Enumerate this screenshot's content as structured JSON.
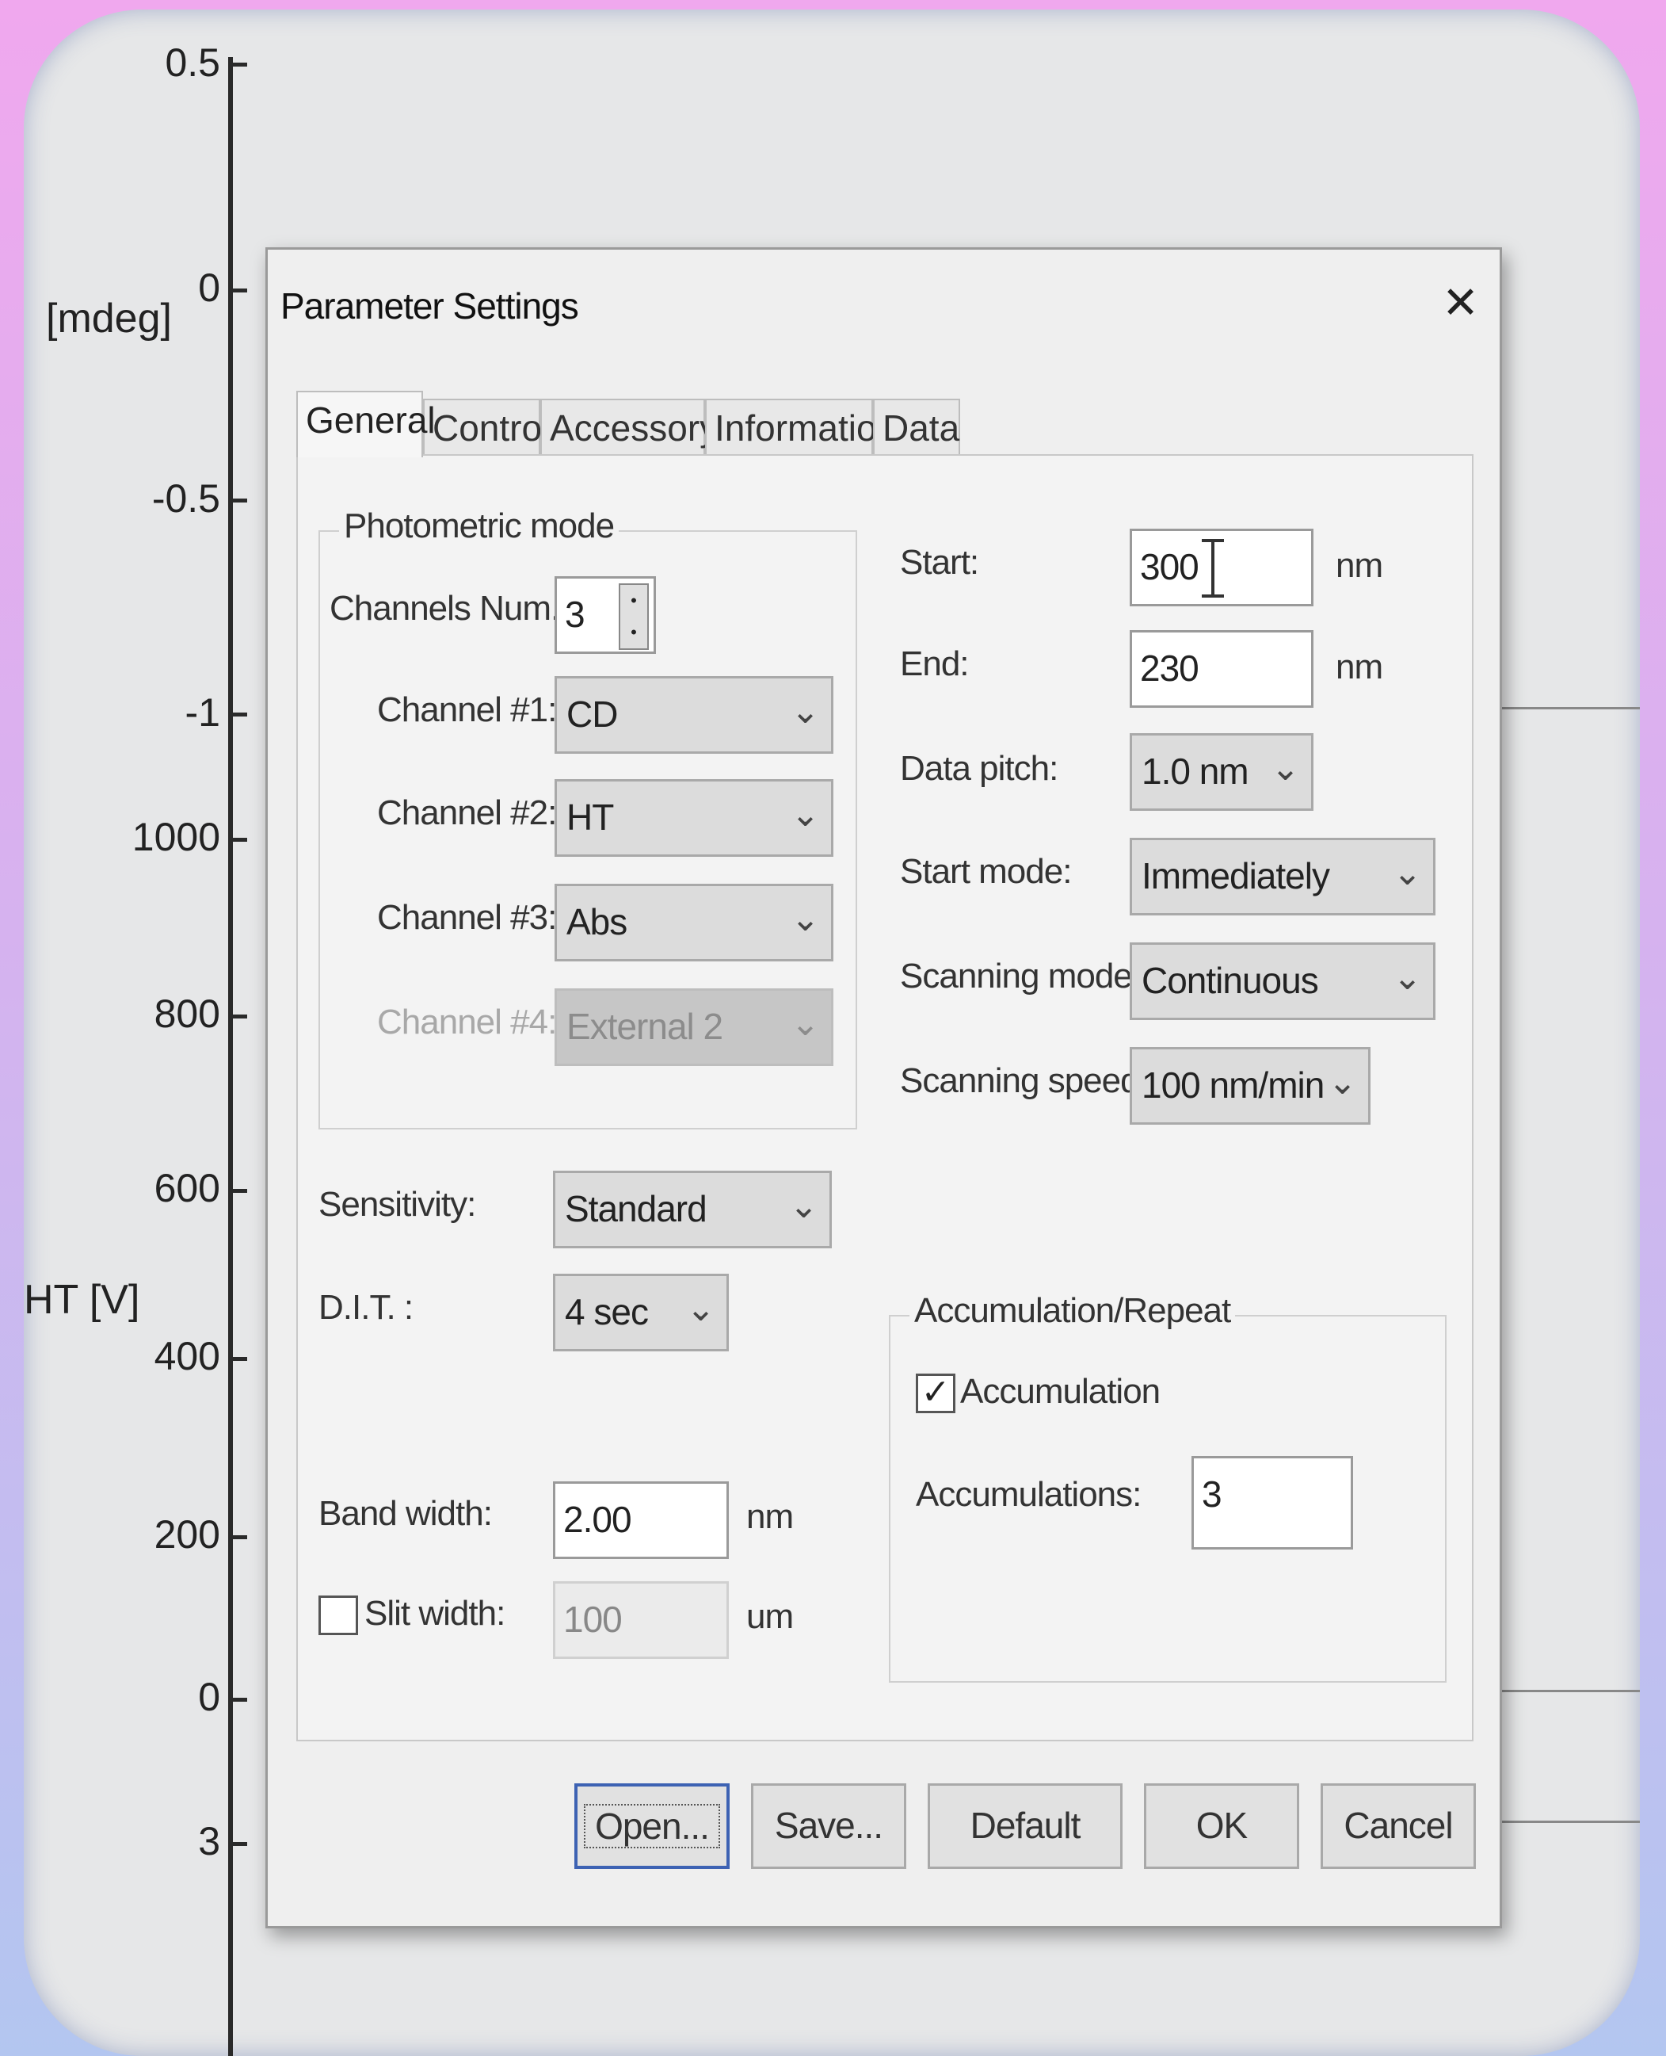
{
  "plot": {
    "y_label_top": "[mdeg]",
    "y_label_bottom": "HT [V]",
    "ticks_top": [
      "0.5",
      "0",
      "-0.5",
      "-1"
    ],
    "ticks_bottom": [
      "1000",
      "800",
      "600",
      "400",
      "200",
      "0"
    ],
    "tick_extra": "3"
  },
  "dialog": {
    "title": "Parameter Settings",
    "close_glyph": "✕",
    "tabs": [
      "General",
      "Control",
      "Accessory",
      "Information",
      "Data"
    ],
    "photometric": {
      "group_title": "Photometric mode",
      "channels_num_label": "Channels Num.",
      "channels_num_value": "3",
      "channel1_label": "Channel #1:",
      "channel1_value": "CD",
      "channel2_label": "Channel #2:",
      "channel2_value": "HT",
      "channel3_label": "Channel #3:",
      "channel3_value": "Abs",
      "channel4_label": "Channel #4:",
      "channel4_value": "External 2"
    },
    "sensitivity_label": "Sensitivity:",
    "sensitivity_value": "Standard",
    "dit_label": "D.I.T. :",
    "dit_value": "4 sec",
    "bandwidth_label": "Band width:",
    "bandwidth_value": "2.00",
    "bandwidth_unit": "nm",
    "slit_label": "Slit width:",
    "slit_value": "100",
    "slit_unit": "um",
    "slit_checked": false,
    "start_label": "Start:",
    "start_value": "300",
    "start_unit": "nm",
    "end_label": "End:",
    "end_value": "230",
    "end_unit": "nm",
    "data_pitch_label": "Data pitch:",
    "data_pitch_value": "1.0 nm",
    "start_mode_label": "Start mode:",
    "start_mode_value": "Immediately",
    "scanning_mode_label": "Scanning mode:",
    "scanning_mode_value": "Continuous",
    "scanning_speed_label": "Scanning speed:",
    "scanning_speed_value": "100 nm/min",
    "accumulation": {
      "group_title": "Accumulation/Repeat",
      "checkbox_label": "Accumulation",
      "checked": true,
      "count_label": "Accumulations:",
      "count_value": "3"
    },
    "buttons": {
      "open": "Open...",
      "save": "Save...",
      "default": "Default",
      "ok": "OK",
      "cancel": "Cancel"
    },
    "chevron_glyph": "⌄",
    "check_glyph": "✓"
  }
}
